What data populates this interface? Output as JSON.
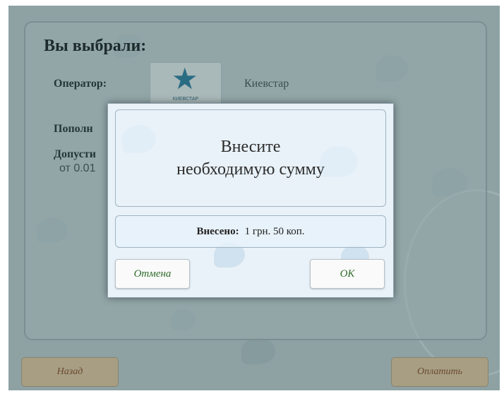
{
  "summary": {
    "title": "Вы выбрали:",
    "operator_label": "Оператор:",
    "operator_value": "Киевстар",
    "operator_logo_text": "КИЕВСТАР",
    "topup_label": "Пополн",
    "allowed_label": "Допусти",
    "range_text": "от 0.01"
  },
  "dialog": {
    "message_line1": "Внесите",
    "message_line2": "необходимую сумму",
    "paid_label": "Внесено:",
    "paid_value": "1 грн. 50 коп.",
    "cancel_label": "Отмена",
    "ok_label": "OK"
  },
  "footer": {
    "back_label": "Назад",
    "pay_label": "Оплатить"
  },
  "colors": {
    "annotation": "#e0201c",
    "button_text": "#2e6b2a"
  }
}
